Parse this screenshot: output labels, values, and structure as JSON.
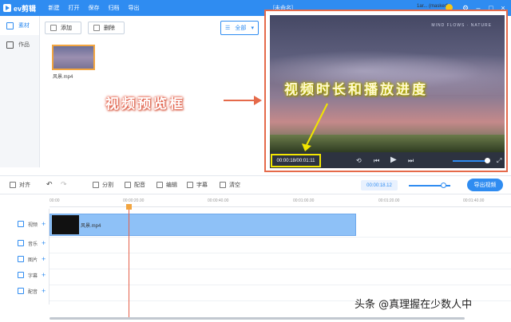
{
  "app": {
    "name": "ev剪辑",
    "menu": [
      "新建",
      "打开",
      "保存",
      "归档",
      "导出"
    ],
    "doc_title": "[未命名]",
    "user": "1ar... (masked)"
  },
  "sidebar": {
    "items": [
      {
        "label": "素材",
        "active": true
      },
      {
        "label": "作品",
        "active": false
      }
    ]
  },
  "library": {
    "add_label": "添加",
    "delete_label": "删除",
    "filter_label": "全部",
    "clip_name": "风景.mp4"
  },
  "preview": {
    "time": "00:00:18/00:01:11",
    "watermark": "MIND FLOWS  ·  NATURE"
  },
  "annotations": {
    "left": "视频预览框",
    "mid": "视频时长和播放进度"
  },
  "edit_toolbar": {
    "align": "对齐",
    "split": "分割",
    "dub": "配音",
    "edit": "编辑",
    "subtitle": "字幕",
    "clear": "清空",
    "time": "00:00:18.12",
    "export": "导出视频"
  },
  "ruler": [
    "00:00",
    "00:00:20.00",
    "00:00:40.00",
    "00:01:00.00",
    "00:01:20.00",
    "00:01:40.00"
  ],
  "tracks": [
    "视频",
    "音乐",
    "图片",
    "字幕",
    "配音"
  ],
  "timeline_clip": "风景.mp4",
  "page_watermark": "头条 @真理握在少数人中",
  "colors": {
    "accent": "#2f8cf1",
    "annotation_box": "#e56a4a",
    "highlight": "#f2e600"
  }
}
